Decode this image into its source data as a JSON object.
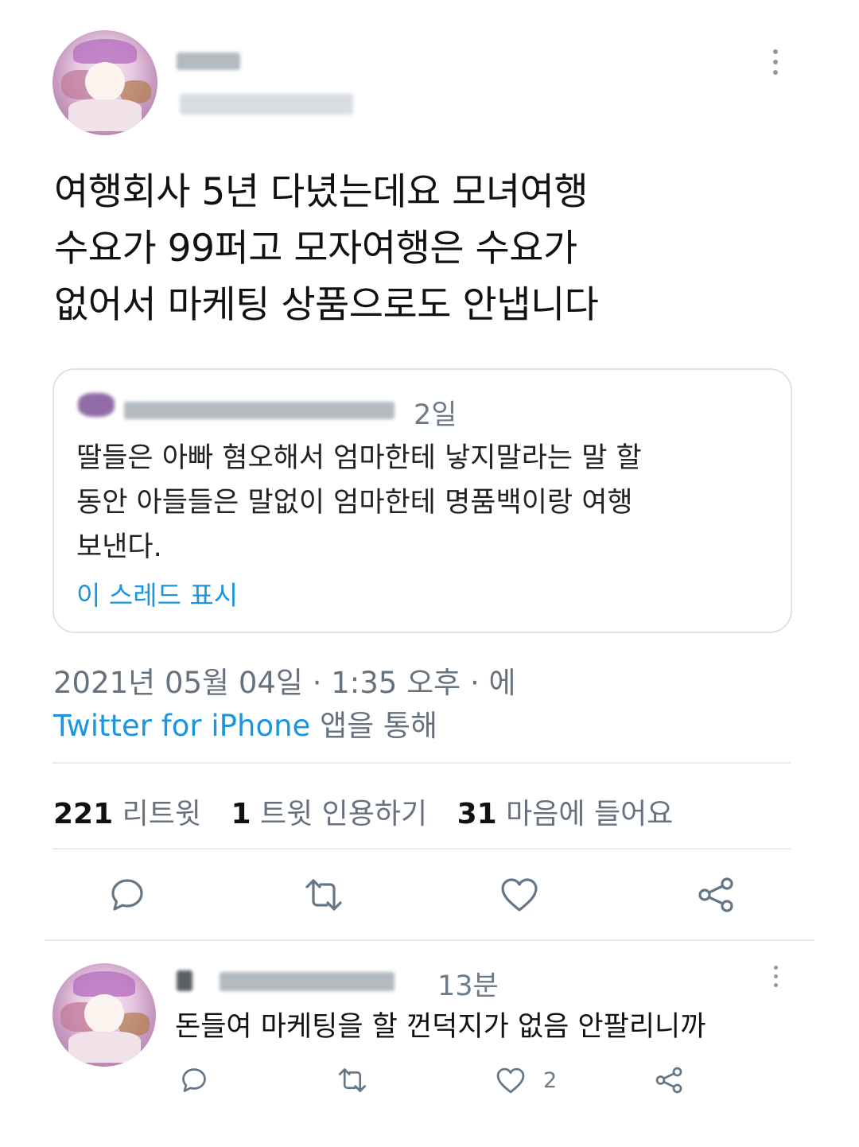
{
  "main_tweet": {
    "text_lines": [
      "여행회사 5년 다녔는데요 모녀여행",
      "수요가 99퍼고 모자여행은 수요가",
      "없어서 마케팅 상품으로도 안냅니다"
    ]
  },
  "quoted_tweet": {
    "time": "2일",
    "text_lines": [
      "딸들은 아빠 혐오해서 엄마한테 낳지말라는 말 할",
      "동안 아들들은 말없이 엄마한테 명품백이랑 여행",
      "보낸다."
    ],
    "show_thread": "이 스레드 표시"
  },
  "meta": {
    "date_line": "2021년 05월 04일 · 1:35 오후 · 에",
    "source_app": "Twitter for iPhone",
    "source_suffix": " 앱을 통해"
  },
  "stats": {
    "retweets": "221",
    "retweets_label": "리트윗",
    "quotes": "1",
    "quotes_label": "트윗 인용하기",
    "likes": "31",
    "likes_label": "마음에 들어요"
  },
  "reply": {
    "time": "13분",
    "text": "돈들여 마케팅을 할 껀덕지가 없음 안팔리니까",
    "like_count": "2"
  },
  "colors": {
    "link": "#1b95e0",
    "icon": "#657786",
    "muted": "#66727e"
  },
  "icons": [
    "more-vertical-icon",
    "reply-icon",
    "retweet-icon",
    "like-icon",
    "share-icon"
  ]
}
